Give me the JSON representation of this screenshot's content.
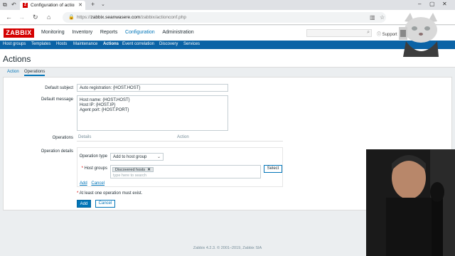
{
  "browser": {
    "tab_title": "Configuration of actions",
    "favicon_letter": "Z",
    "url_host": "zabbix.seanwasere.com",
    "url_path": "/zabbix/actionconf.php",
    "url_scheme": "https://"
  },
  "zabbix": {
    "logo": "ZABBIX",
    "menu": [
      "Monitoring",
      "Inventory",
      "Reports",
      "Configuration",
      "Administration"
    ],
    "active_menu": "Configuration",
    "support": "Support",
    "submenu": [
      "Host groups",
      "Templates",
      "Hosts",
      "Maintenance",
      "Actions",
      "Event correlation",
      "Discovery",
      "Services"
    ],
    "active_submenu": "Actions",
    "accent": "#0275b8",
    "brand": "#d40000"
  },
  "page": {
    "title": "Actions",
    "tabs": [
      "Action",
      "Operations"
    ],
    "active_tab": "Operations"
  },
  "form": {
    "default_subject_label": "Default subject",
    "default_subject_value": "Auto registration: {HOST.HOST}",
    "default_message_label": "Default message",
    "default_message_lines": [
      "Host name: {HOST.HOST}",
      "Host IP: {HOST.IP}",
      "Agent port: {HOST.PORT}"
    ],
    "operations_label": "Operations",
    "operations_col_details": "Details",
    "operations_col_action": "Action",
    "operation_details_label": "Operation details",
    "operation_type_label": "Operation type",
    "operation_type_value": "Add to host group",
    "host_groups_label": "Host groups",
    "host_groups_chip": "Discovered hosts",
    "host_groups_placeholder": "type here to search",
    "select_button": "Select",
    "add_link": "Add",
    "cancel_link": "Cancel",
    "note": "At least one operation must exist.",
    "add_button": "Add",
    "cancel_button": "Cancel"
  },
  "footer": "Zabbix 4.2.3. © 2001–2019, Zabbix SIA"
}
